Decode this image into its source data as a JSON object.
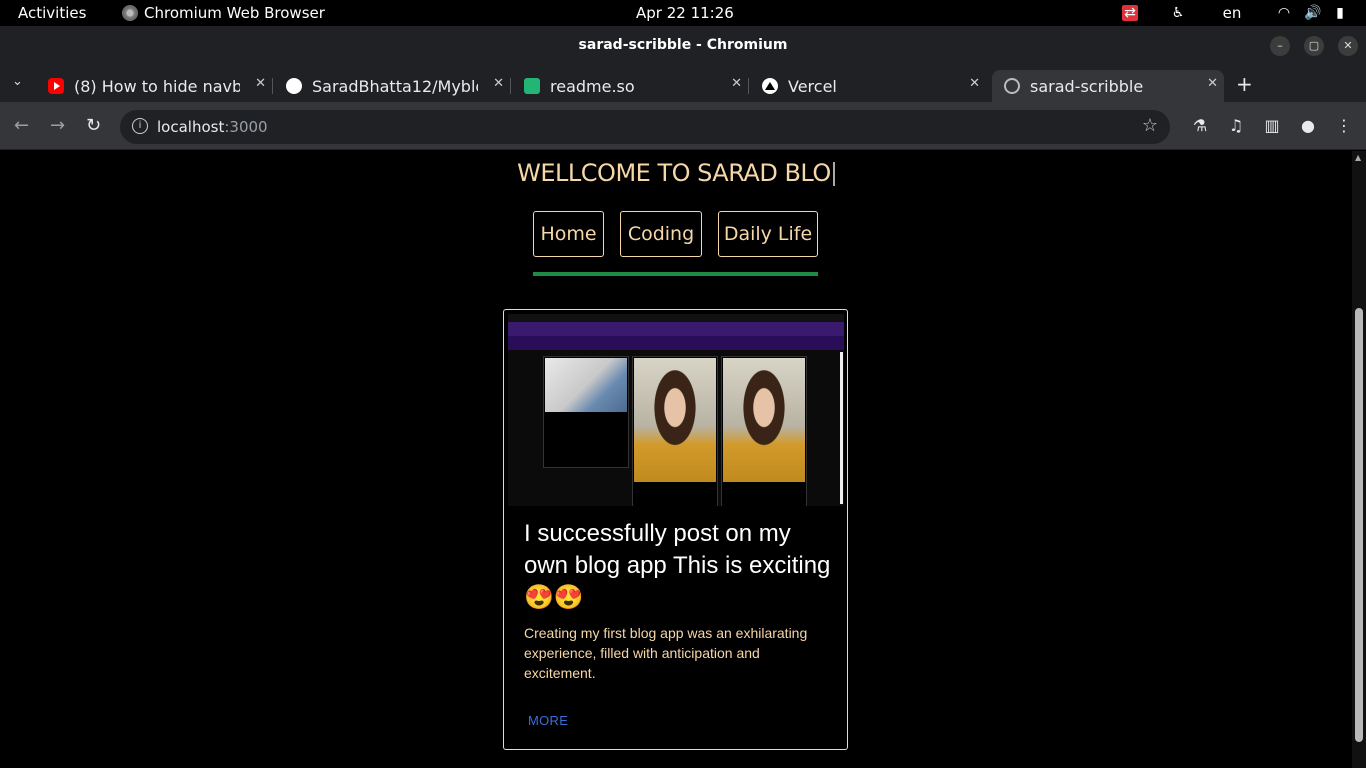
{
  "system_bar": {
    "activities": "Activities",
    "app_name": "Chromium Web Browser",
    "clock": "Apr 22  11:26",
    "language": "en"
  },
  "window": {
    "title": "sarad-scribble - Chromium"
  },
  "tabs": [
    {
      "label": "(8) How to hide navbar",
      "icon": "youtube-icon"
    },
    {
      "label": "SaradBhatta12/Myblog",
      "icon": "github-icon"
    },
    {
      "label": "readme.so",
      "icon": "readme-icon"
    },
    {
      "label": "Vercel",
      "icon": "vercel-icon"
    },
    {
      "label": "sarad-scribble",
      "icon": "globe-icon",
      "active": true
    }
  ],
  "address_bar": {
    "host": "localhost",
    "port": ":3000"
  },
  "page": {
    "heading": "WELLCOME TO SARAD BLO",
    "nav": [
      {
        "label": "Home"
      },
      {
        "label": "Coding"
      },
      {
        "label": "Daily Life"
      }
    ],
    "posts": [
      {
        "title": "I successfully post on my own blog app This is exciting 😍😍",
        "excerpt": "Creating my first blog app was an exhilarating experience, filled with anticipation and excitement.",
        "more_label": "MORE"
      }
    ]
  },
  "colors": {
    "accent_text": "#f5d7a8",
    "underline": "#1e8a45",
    "link": "#3b6fd6",
    "background": "#000000"
  }
}
